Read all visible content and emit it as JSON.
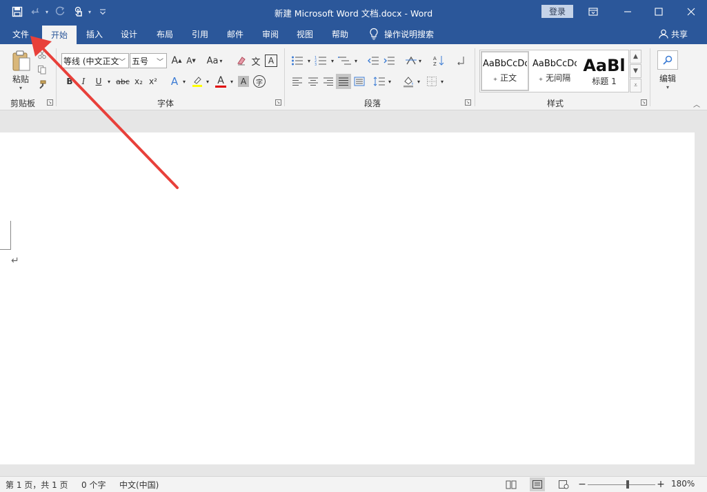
{
  "window": {
    "title": "新建 Microsoft Word 文档.docx - Word",
    "login_label": "登录",
    "ribbon_display_icon": "ribbon-display-icon",
    "minimize_icon": "minimize-icon",
    "maximize_icon": "maximize-icon",
    "close_icon": "close-icon"
  },
  "quick_access": {
    "save_icon": "save-icon",
    "undo_icon": "undo-icon",
    "redo_icon": "redo-icon",
    "touch_mode_icon": "touch-mode-icon",
    "customize_icon": "customize-icon"
  },
  "tabs": [
    {
      "label": "文件"
    },
    {
      "label": "开始"
    },
    {
      "label": "插入"
    },
    {
      "label": "设计"
    },
    {
      "label": "布局"
    },
    {
      "label": "引用"
    },
    {
      "label": "邮件"
    },
    {
      "label": "审阅"
    },
    {
      "label": "视图"
    },
    {
      "label": "帮助"
    }
  ],
  "active_tab": "开始",
  "tell_me": "操作说明搜索",
  "share_label": "共享",
  "ribbon": {
    "clipboard": {
      "group_label": "剪贴板",
      "paste_label": "粘贴"
    },
    "font": {
      "group_label": "字体",
      "font_name": "等线 (中文正文",
      "font_size": "五号",
      "bold": "B",
      "italic": "I",
      "underline": "U",
      "strike": "abc",
      "subscript": "x₂",
      "superscript": "x²",
      "change_case": "Aa",
      "font_color_letter": "A",
      "grow_letter": "A",
      "shrink_letter": "A",
      "char_shading_letter": "A",
      "char_border_letter": "A",
      "enclose_char": "字"
    },
    "paragraph": {
      "group_label": "段落"
    },
    "styles": {
      "group_label": "样式",
      "items": [
        {
          "sample": "AaBbCcDc",
          "name": "₊ 正文"
        },
        {
          "sample": "AaBbCcDc",
          "name": "₊ 无间隔"
        },
        {
          "sample": "AaBl",
          "name": "标题 1"
        }
      ]
    },
    "editing": {
      "group_label": "编辑"
    }
  },
  "document": {
    "paragraph_mark": "↵"
  },
  "status": {
    "page": "第 1 页，共 1 页",
    "words": "0 个字",
    "language": "中文(中国)",
    "zoom": "180%"
  },
  "colors": {
    "title_bar": "#2b579a",
    "ribbon": "#f3f3f3",
    "arrow": "#e8403a",
    "highlight": "#ffff00",
    "font_color": "#e00000"
  }
}
